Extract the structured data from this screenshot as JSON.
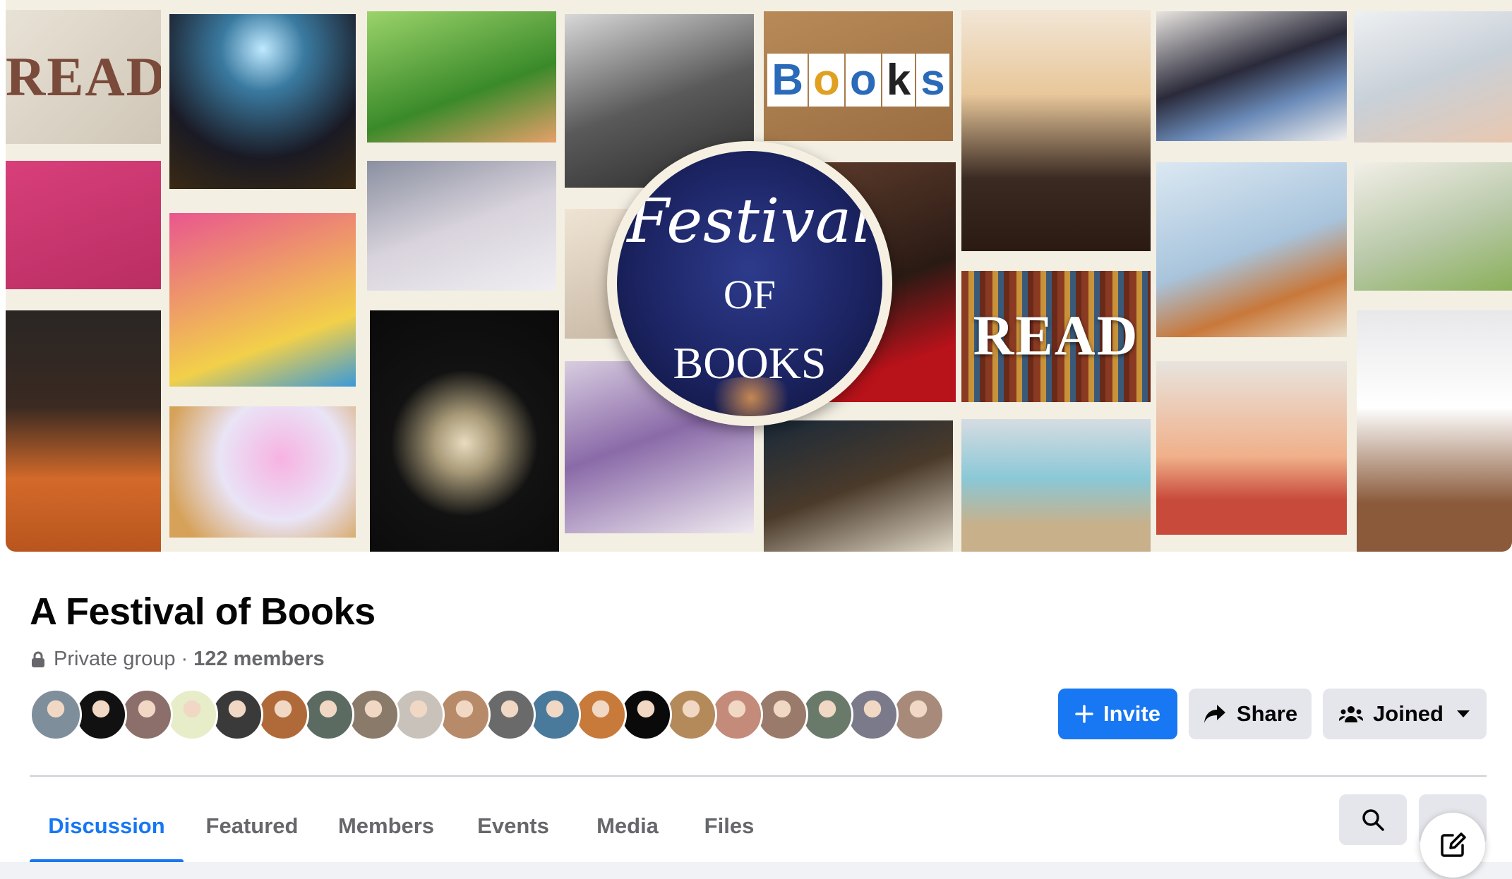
{
  "cover": {
    "words": {
      "read_top": "READ",
      "books_board": "BOOKS",
      "read_shelf": "READ"
    },
    "festival_badge": {
      "line1": "Festival",
      "line2": "OF",
      "line3": "BOOKS"
    }
  },
  "group": {
    "name": "A Festival of Books",
    "privacy": "Private group",
    "separator": "·",
    "members": "122 members"
  },
  "member_avatars": [
    "#7f8e9b",
    "#111111",
    "#8c6f6a",
    "#e6edc8",
    "#3a3a3a",
    "#b06a3a",
    "#5b6b62",
    "#8a7a6a",
    "#c9c2ba",
    "#b78a6a",
    "#6a6a6a",
    "#4a7a9b",
    "#c87a3a",
    "#0a0a0a",
    "#b48a5a",
    "#c48a7a",
    "#9a7a6a",
    "#6a7a6a",
    "#7a7a8a",
    "#a88a7a"
  ],
  "actions": {
    "invite": "Invite",
    "share": "Share",
    "joined": "Joined"
  },
  "tabs": [
    {
      "label": "Discussion",
      "active": true
    },
    {
      "label": "Featured",
      "active": false
    },
    {
      "label": "Members",
      "active": false
    },
    {
      "label": "Events",
      "active": false
    },
    {
      "label": "Media",
      "active": false
    },
    {
      "label": "Files",
      "active": false
    }
  ],
  "icons": {
    "lock": "lock-icon",
    "invite": "plus-icon",
    "share": "share-arrow-icon",
    "joined": "people-group-icon",
    "joined_caret": "caret-down-icon",
    "search": "search-icon",
    "more": "more-horizontal-icon",
    "compose": "compose-icon"
  },
  "colors": {
    "accent": "#1877f2",
    "secondary_button": "#e4e6eb",
    "muted_text": "#65676b"
  }
}
